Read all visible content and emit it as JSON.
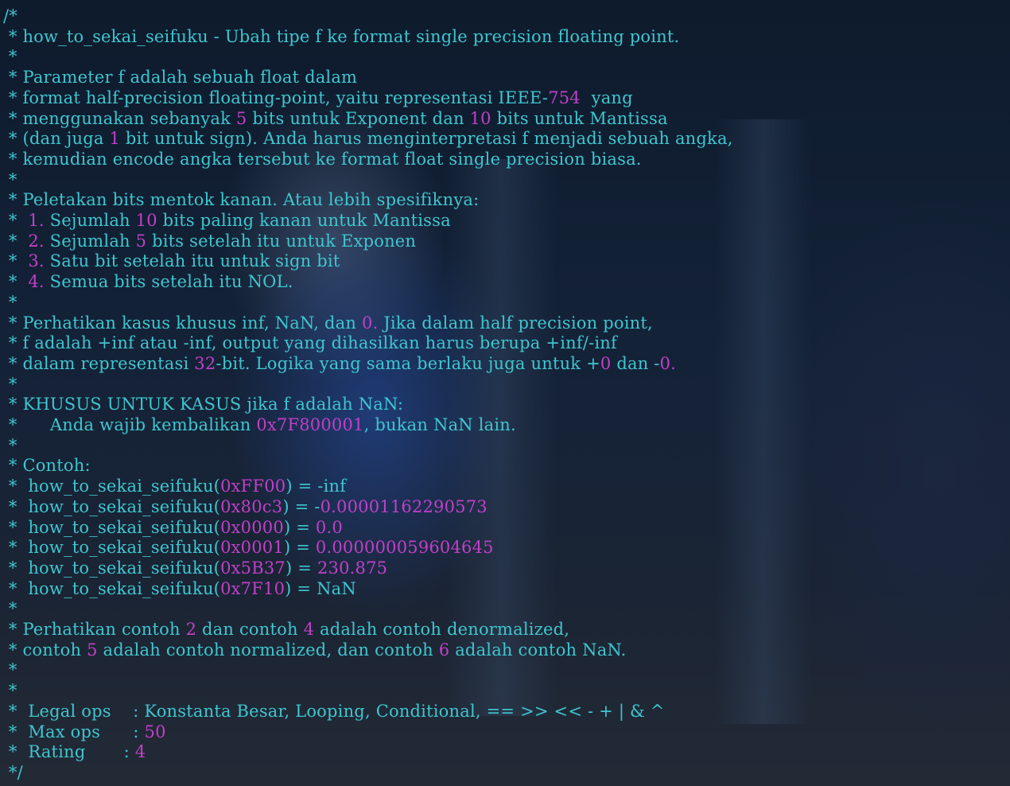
{
  "colors": {
    "text": "#3fc6cf",
    "number": "#c040c8",
    "background": "#0d1a2c"
  },
  "lines": [
    [
      {
        "t": "/*",
        "c": "txt"
      }
    ],
    [
      {
        "t": " * how_to_sekai_seifuku - Ubah tipe f ke format single precision floating point.",
        "c": "txt"
      }
    ],
    [
      {
        "t": " *",
        "c": "txt"
      }
    ],
    [
      {
        "t": " * Parameter f adalah sebuah float dalam",
        "c": "txt"
      }
    ],
    [
      {
        "t": " * format half-precision floating-point, yaitu representasi IEEE-",
        "c": "txt"
      },
      {
        "t": "754",
        "c": "num"
      },
      {
        "t": "  yang",
        "c": "txt"
      }
    ],
    [
      {
        "t": " * menggunakan sebanyak ",
        "c": "txt"
      },
      {
        "t": "5",
        "c": "num"
      },
      {
        "t": " bits untuk Exponent dan ",
        "c": "txt"
      },
      {
        "t": "10",
        "c": "num"
      },
      {
        "t": " bits untuk Mantissa",
        "c": "txt"
      }
    ],
    [
      {
        "t": " * (dan juga ",
        "c": "txt"
      },
      {
        "t": "1",
        "c": "num"
      },
      {
        "t": " bit untuk sign). Anda harus menginterpretasi f menjadi sebuah angka,",
        "c": "txt"
      }
    ],
    [
      {
        "t": " * kemudian encode angka tersebut ke format float single precision biasa.",
        "c": "txt"
      }
    ],
    [
      {
        "t": " *",
        "c": "txt"
      }
    ],
    [
      {
        "t": " * Peletakan bits mentok kanan. Atau lebih spesifiknya:",
        "c": "txt"
      }
    ],
    [
      {
        "t": " *  ",
        "c": "txt"
      },
      {
        "t": "1.",
        "c": "num"
      },
      {
        "t": " Sejumlah ",
        "c": "txt"
      },
      {
        "t": "10",
        "c": "num"
      },
      {
        "t": " bits paling kanan untuk Mantissa",
        "c": "txt"
      }
    ],
    [
      {
        "t": " *  ",
        "c": "txt"
      },
      {
        "t": "2.",
        "c": "num"
      },
      {
        "t": " Sejumlah ",
        "c": "txt"
      },
      {
        "t": "5",
        "c": "num"
      },
      {
        "t": " bits setelah itu untuk Exponen",
        "c": "txt"
      }
    ],
    [
      {
        "t": " *  ",
        "c": "txt"
      },
      {
        "t": "3.",
        "c": "num"
      },
      {
        "t": " Satu bit setelah itu untuk sign bit",
        "c": "txt"
      }
    ],
    [
      {
        "t": " *  ",
        "c": "txt"
      },
      {
        "t": "4.",
        "c": "num"
      },
      {
        "t": " Semua bits setelah itu NOL.",
        "c": "txt"
      }
    ],
    [
      {
        "t": " *",
        "c": "txt"
      }
    ],
    [
      {
        "t": " * Perhatikan kasus khusus inf, NaN, dan ",
        "c": "txt"
      },
      {
        "t": "0.",
        "c": "num"
      },
      {
        "t": " Jika dalam half precision point,",
        "c": "txt"
      }
    ],
    [
      {
        "t": " * f adalah +inf atau -inf, output yang dihasilkan harus berupa +inf/-inf",
        "c": "txt"
      }
    ],
    [
      {
        "t": " * dalam representasi ",
        "c": "txt"
      },
      {
        "t": "32",
        "c": "num"
      },
      {
        "t": "-bit. Logika yang sama berlaku juga untuk +",
        "c": "txt"
      },
      {
        "t": "0",
        "c": "num"
      },
      {
        "t": " dan -",
        "c": "txt"
      },
      {
        "t": "0.",
        "c": "num"
      }
    ],
    [
      {
        "t": " *",
        "c": "txt"
      }
    ],
    [
      {
        "t": " * KHUSUS UNTUK KASUS jika f adalah NaN:",
        "c": "txt"
      }
    ],
    [
      {
        "t": " *      Anda wajib kembalikan ",
        "c": "txt"
      },
      {
        "t": "0x7F800001",
        "c": "num"
      },
      {
        "t": ", bukan NaN lain.",
        "c": "txt"
      }
    ],
    [
      {
        "t": " *",
        "c": "txt"
      }
    ],
    [
      {
        "t": " * Contoh:",
        "c": "txt"
      }
    ],
    [
      {
        "t": " *  how_to_sekai_seifuku(",
        "c": "txt"
      },
      {
        "t": "0xFF00",
        "c": "num"
      },
      {
        "t": ") = -inf",
        "c": "txt"
      }
    ],
    [
      {
        "t": " *  how_to_sekai_seifuku(",
        "c": "txt"
      },
      {
        "t": "0x80c3",
        "c": "num"
      },
      {
        "t": ") = -",
        "c": "txt"
      },
      {
        "t": "0.00001162290573",
        "c": "num"
      }
    ],
    [
      {
        "t": " *  how_to_sekai_seifuku(",
        "c": "txt"
      },
      {
        "t": "0x0000",
        "c": "num"
      },
      {
        "t": ") = ",
        "c": "txt"
      },
      {
        "t": "0.0",
        "c": "num"
      }
    ],
    [
      {
        "t": " *  how_to_sekai_seifuku(",
        "c": "txt"
      },
      {
        "t": "0x0001",
        "c": "num"
      },
      {
        "t": ") = ",
        "c": "txt"
      },
      {
        "t": "0.000000059604645",
        "c": "num"
      }
    ],
    [
      {
        "t": " *  how_to_sekai_seifuku(",
        "c": "txt"
      },
      {
        "t": "0x5B37",
        "c": "num"
      },
      {
        "t": ") = ",
        "c": "txt"
      },
      {
        "t": "230.875",
        "c": "num"
      }
    ],
    [
      {
        "t": " *  how_to_sekai_seifuku(",
        "c": "txt"
      },
      {
        "t": "0x7F10",
        "c": "num"
      },
      {
        "t": ") = NaN",
        "c": "txt"
      }
    ],
    [
      {
        "t": " *",
        "c": "txt"
      }
    ],
    [
      {
        "t": " * Perhatikan contoh ",
        "c": "txt"
      },
      {
        "t": "2",
        "c": "num"
      },
      {
        "t": " dan contoh ",
        "c": "txt"
      },
      {
        "t": "4",
        "c": "num"
      },
      {
        "t": " adalah contoh denormalized,",
        "c": "txt"
      }
    ],
    [
      {
        "t": " * contoh ",
        "c": "txt"
      },
      {
        "t": "5",
        "c": "num"
      },
      {
        "t": " adalah contoh normalized, dan contoh ",
        "c": "txt"
      },
      {
        "t": "6",
        "c": "num"
      },
      {
        "t": " adalah contoh NaN.",
        "c": "txt"
      }
    ],
    [
      {
        "t": " *",
        "c": "txt"
      }
    ],
    [
      {
        "t": " *",
        "c": "txt"
      }
    ],
    [
      {
        "t": " *  Legal ops    : Konstanta Besar, Looping, Conditional, == >> << - + | & ^",
        "c": "txt"
      }
    ],
    [
      {
        "t": " *  Max ops      : ",
        "c": "txt"
      },
      {
        "t": "50",
        "c": "num"
      }
    ],
    [
      {
        "t": " *  Rating       : ",
        "c": "txt"
      },
      {
        "t": "4",
        "c": "num"
      }
    ],
    [
      {
        "t": " */",
        "c": "txt"
      }
    ]
  ]
}
